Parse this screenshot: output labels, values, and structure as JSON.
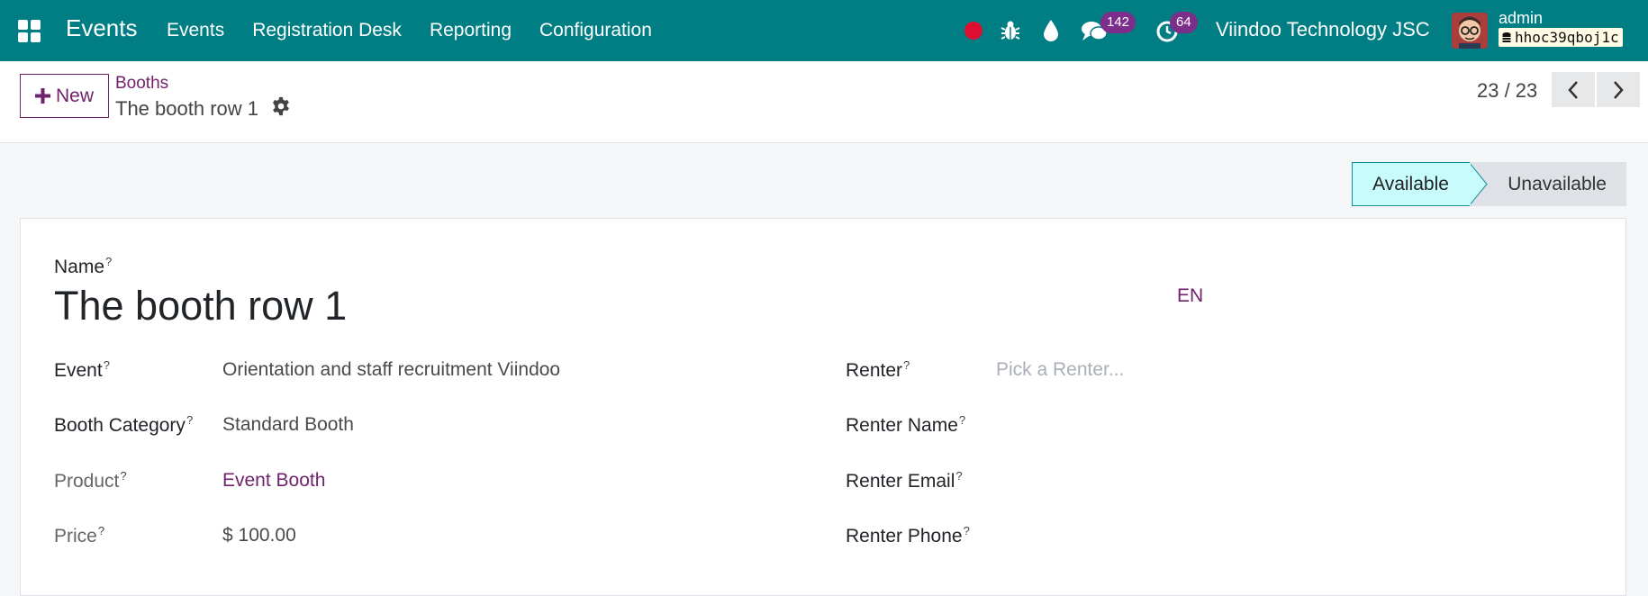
{
  "navbar": {
    "app_name": "Events",
    "menu": [
      "Events",
      "Registration Desk",
      "Reporting",
      "Configuration"
    ],
    "messages_badge": "142",
    "activities_badge": "64",
    "company": "Viindoo Technology JSC",
    "user": "admin",
    "database": "hhoc39qboj1c",
    "icons": [
      "apps-icon",
      "recording-dot-icon",
      "bug-icon",
      "drop-icon",
      "chat-icon",
      "clock-icon",
      "database-icon"
    ]
  },
  "control": {
    "new_label": "New",
    "breadcrumb_parent": "Booths",
    "breadcrumb_current": "The booth row 1",
    "pager": "23 / 23"
  },
  "status": {
    "active": "Available",
    "other": "Unavailable",
    "active_color": "#c8fbfc"
  },
  "form": {
    "name_label": "Name",
    "name_value": "The booth row 1",
    "lang": "EN",
    "help_mark": "?",
    "left": [
      {
        "label": "Event",
        "value": "Orientation and staff recruitment Viindoo"
      },
      {
        "label": "Booth Category",
        "value": "Standard Booth"
      },
      {
        "label": "Product",
        "value": "Event Booth"
      },
      {
        "label": "Price",
        "value": "$ 100.00"
      }
    ],
    "right": [
      {
        "label": "Renter",
        "placeholder": "Pick a Renter..."
      },
      {
        "label": "Renter Name"
      },
      {
        "label": "Renter Email"
      },
      {
        "label": "Renter Phone"
      }
    ]
  },
  "colors": {
    "navbar": "#017e84",
    "accent": "#71226c",
    "badge": "#7c2f8a",
    "record": "#dc0f32"
  }
}
